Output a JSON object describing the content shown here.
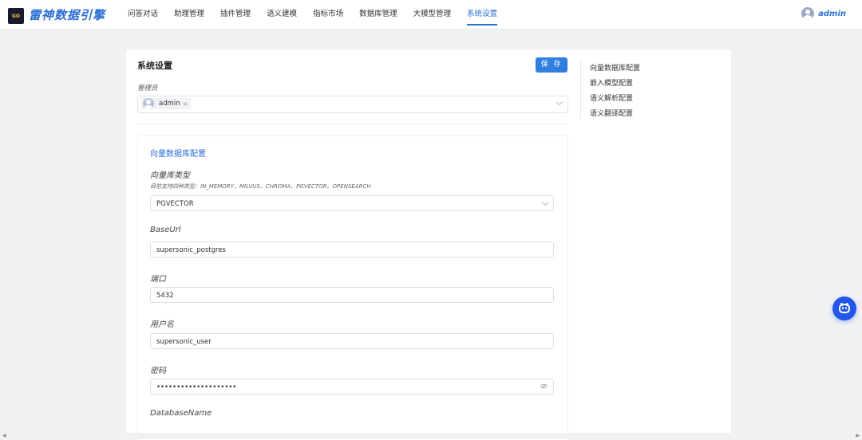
{
  "header": {
    "logo_text": "雷神数据引擎",
    "logo_glyph": "GO",
    "nav": [
      "问答对话",
      "助理管理",
      "插件管理",
      "语义建模",
      "指标市场",
      "数据库管理",
      "大模型管理",
      "系统设置"
    ],
    "active_nav": "系统设置",
    "user": "admin"
  },
  "colors": {
    "accent": "#2b6fd6",
    "button": "#2f7ee0",
    "bot": "#2255e8"
  },
  "settings": {
    "title": "系统设置",
    "save_label": "保 存",
    "admin_label": "管理员",
    "admin_tag": "admin",
    "admin_tag_remove": "×"
  },
  "vector_db": {
    "section_title": "向量数据库配置",
    "type_label": "向量库类型",
    "type_hint": "目前支持四种类型：IN_MEMORY、MILVUS、CHROMA、PGVECTOR、OPENSEARCH",
    "type_value": "PGVECTOR",
    "baseurl_label": "BaseUrl",
    "baseurl_value": "supersonic_postgres",
    "port_label": "端口",
    "port_value": "5432",
    "username_label": "用户名",
    "username_value": "supersonic_user",
    "password_label": "密码",
    "password_value": "••••••••••••••••••••",
    "dbname_label": "DatabaseName"
  },
  "anchors": [
    "向量数据库配置",
    "嵌入模型配置",
    "语义解析配置",
    "语义翻译配置"
  ],
  "icons": {
    "eye": "eye-slash-icon",
    "bot": "robot-icon",
    "chevron": "chevron-down-icon",
    "user": "user-avatar-icon"
  },
  "scroll": {
    "left": "◀",
    "right": "▶"
  }
}
